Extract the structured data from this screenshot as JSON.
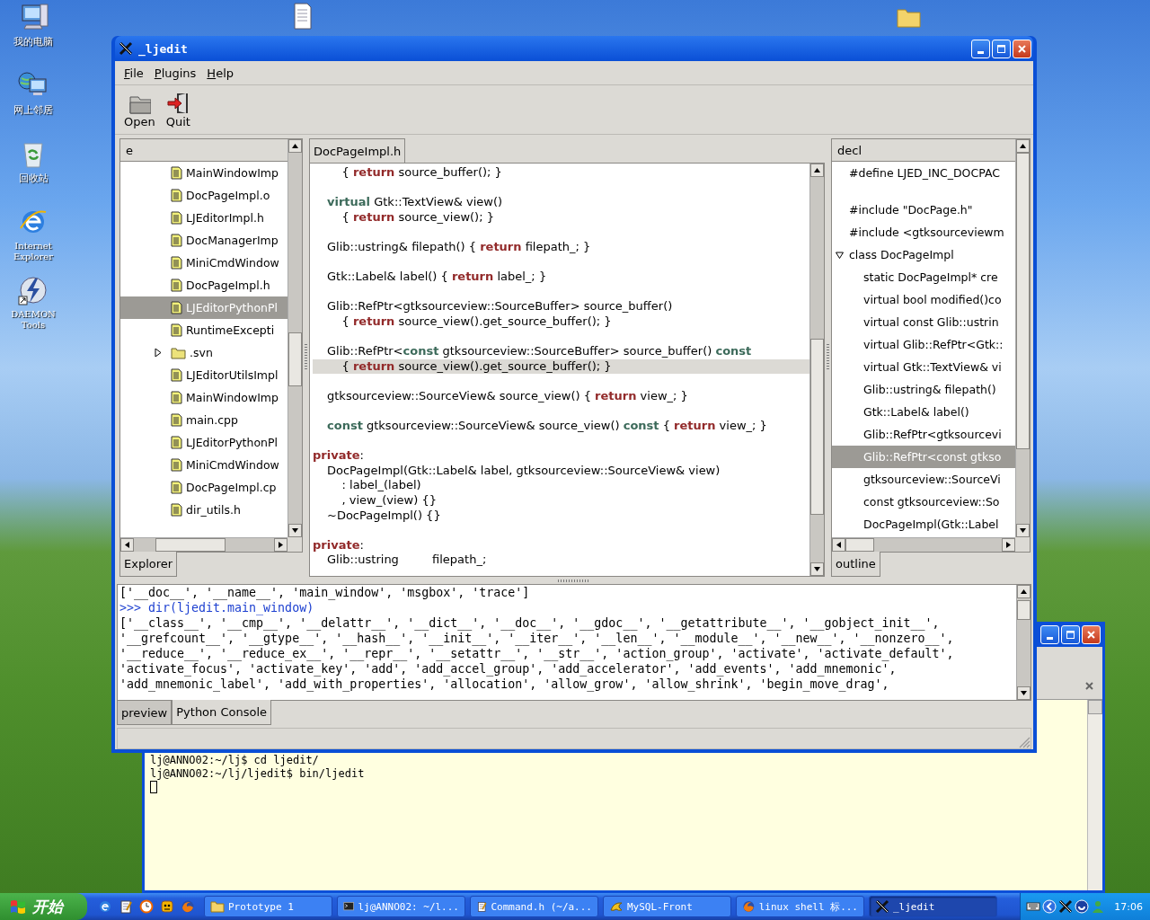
{
  "desktop_icons": [
    {
      "label": "我的电脑"
    },
    {
      "label": "网上邻居"
    },
    {
      "label": "回收站"
    },
    {
      "label": "Internet Explorer"
    },
    {
      "label": "DAEMON Tools"
    }
  ],
  "window": {
    "title": "_ljedit"
  },
  "menu": [
    "File",
    "Plugins",
    "Help"
  ],
  "toolbar": [
    {
      "label": "Open"
    },
    {
      "label": "Quit"
    }
  ],
  "explorer": {
    "column_1": "e",
    "items": [
      {
        "kind": "file",
        "label": "MainWindowImp",
        "selected": false
      },
      {
        "kind": "file",
        "label": "DocPageImpl.o",
        "selected": false
      },
      {
        "kind": "file",
        "label": "LJEditorImpl.h",
        "selected": false
      },
      {
        "kind": "file",
        "label": "DocManagerImp",
        "selected": false
      },
      {
        "kind": "file",
        "label": "MiniCmdWindow",
        "selected": false
      },
      {
        "kind": "file",
        "label": "DocPageImpl.h",
        "selected": false
      },
      {
        "kind": "file",
        "label": "LJEditorPythonPl",
        "selected": true
      },
      {
        "kind": "file",
        "label": "RuntimeExcepti",
        "selected": false
      },
      {
        "kind": "folder",
        "label": ".svn",
        "selected": false,
        "expanded": false
      },
      {
        "kind": "file",
        "label": "LJEditorUtilsImpl",
        "selected": false
      },
      {
        "kind": "file",
        "label": "MainWindowImp",
        "selected": false
      },
      {
        "kind": "file",
        "label": "main.cpp",
        "selected": false
      },
      {
        "kind": "file",
        "label": "LJEditorPythonPl",
        "selected": false
      },
      {
        "kind": "file",
        "label": "MiniCmdWindow",
        "selected": false
      },
      {
        "kind": "file",
        "label": "DocPageImpl.cp",
        "selected": false
      },
      {
        "kind": "file",
        "label": "dir_utils.h",
        "selected": false
      }
    ],
    "tabs": [
      {
        "label": "Explorer",
        "selected": true
      }
    ]
  },
  "editor": {
    "tabs": [
      {
        "label": "DocPageImpl.h",
        "selected": true
      }
    ],
    "blocks": [
      {
        "lines": [
          {
            "indented": true,
            "highlighted": false,
            "segments": [
              {
                "kind": "plain",
                "text": "    { "
              },
              {
                "kind": "keyword",
                "text": "return"
              },
              {
                "kind": "plain",
                "text": " source_buffer(); }"
              }
            ]
          }
        ]
      },
      {
        "lines": [
          {
            "indented": true,
            "highlighted": false,
            "segments": [
              {
                "kind": "qualifier",
                "text": "virtual"
              },
              {
                "kind": "plain",
                "text": " Gtk::TextView& view()"
              }
            ]
          },
          {
            "indented": true,
            "highlighted": false,
            "segments": [
              {
                "kind": "plain",
                "text": "    { "
              },
              {
                "kind": "keyword",
                "text": "return"
              },
              {
                "kind": "plain",
                "text": " source_view(); }"
              }
            ]
          }
        ]
      },
      {
        "lines": [
          {
            "indented": true,
            "highlighted": false,
            "segments": [
              {
                "kind": "plain",
                "text": "Glib::ustring& filepath() { "
              },
              {
                "kind": "keyword",
                "text": "return"
              },
              {
                "kind": "plain",
                "text": " filepath_; }"
              }
            ]
          }
        ]
      },
      {
        "lines": [
          {
            "indented": true,
            "highlighted": false,
            "segments": [
              {
                "kind": "plain",
                "text": "Gtk::Label& label() { "
              },
              {
                "kind": "keyword",
                "text": "return"
              },
              {
                "kind": "plain",
                "text": " label_; }"
              }
            ]
          }
        ]
      },
      {
        "lines": [
          {
            "indented": true,
            "highlighted": false,
            "segments": [
              {
                "kind": "plain",
                "text": "Glib::RefPtr<gtksourceview::SourceBuffer> source_buffer()"
              }
            ]
          },
          {
            "indented": true,
            "highlighted": false,
            "segments": [
              {
                "kind": "plain",
                "text": "    { "
              },
              {
                "kind": "keyword",
                "text": "return"
              },
              {
                "kind": "plain",
                "text": " source_view().get_source_buffer(); }"
              }
            ]
          }
        ]
      },
      {
        "lines": [
          {
            "indented": true,
            "highlighted": false,
            "segments": [
              {
                "kind": "plain",
                "text": "Glib::RefPtr<"
              },
              {
                "kind": "qualifier",
                "text": "const"
              },
              {
                "kind": "plain",
                "text": " gtksourceview::SourceBuffer> source_buffer() "
              },
              {
                "kind": "qualifier",
                "text": "const"
              }
            ]
          },
          {
            "indented": true,
            "highlighted": true,
            "segments": [
              {
                "kind": "plain",
                "text": "    { "
              },
              {
                "kind": "keyword",
                "text": "return"
              },
              {
                "kind": "plain",
                "text": " source_view().get_source_buffer(); }"
              }
            ]
          }
        ]
      },
      {
        "lines": [
          {
            "indented": true,
            "highlighted": false,
            "segments": [
              {
                "kind": "plain",
                "text": "gtksourceview::SourceView& source_view() { "
              },
              {
                "kind": "keyword",
                "text": "return"
              },
              {
                "kind": "plain",
                "text": " view_; }"
              }
            ]
          }
        ]
      },
      {
        "lines": [
          {
            "indented": true,
            "highlighted": false,
            "segments": [
              {
                "kind": "qualifier",
                "text": "const"
              },
              {
                "kind": "plain",
                "text": " gtksourceview::SourceView& source_view() "
              },
              {
                "kind": "qualifier",
                "text": "const"
              },
              {
                "kind": "plain",
                "text": " { "
              },
              {
                "kind": "keyword",
                "text": "return"
              },
              {
                "kind": "plain",
                "text": " view_; }"
              }
            ]
          }
        ]
      },
      {
        "lines": [
          {
            "indented": false,
            "highlighted": false,
            "segments": [
              {
                "kind": "keyword",
                "text": "private"
              },
              {
                "kind": "plain",
                "text": ":"
              }
            ]
          },
          {
            "indented": true,
            "highlighted": false,
            "segments": [
              {
                "kind": "plain",
                "text": "DocPageImpl(Gtk::Label& label, gtksourceview::SourceView& view)"
              }
            ]
          },
          {
            "indented": true,
            "highlighted": false,
            "segments": [
              {
                "kind": "plain",
                "text": "    : label_(label)"
              }
            ]
          },
          {
            "indented": true,
            "highlighted": false,
            "segments": [
              {
                "kind": "plain",
                "text": "    , view_(view) {}"
              }
            ]
          },
          {
            "indented": true,
            "highlighted": false,
            "segments": [
              {
                "kind": "plain",
                "text": "~DocPageImpl() {}"
              }
            ]
          }
        ]
      },
      {
        "lines": [
          {
            "indented": false,
            "highlighted": false,
            "segments": [
              {
                "kind": "keyword",
                "text": "private"
              },
              {
                "kind": "plain",
                "text": ":"
              }
            ]
          },
          {
            "indented": true,
            "highlighted": false,
            "segments": [
              {
                "kind": "plain",
                "text": "Glib::ustring         filepath_;"
              }
            ]
          }
        ]
      }
    ]
  },
  "outline": {
    "header": "decl",
    "items": [
      {
        "kind": "decl",
        "label": "#define LJED_INC_DOCPAC",
        "selected": false
      },
      {
        "kind": "blank"
      },
      {
        "kind": "decl",
        "label": "#include \"DocPage.h\"",
        "selected": false
      },
      {
        "kind": "decl",
        "label": "#include <gtksourceviewm",
        "selected": false
      },
      {
        "kind": "decl",
        "label": "class DocPageImpl",
        "selected": false,
        "expanded": true,
        "children": [
          {
            "kind": "decl",
            "label": "static DocPageImpl* cre",
            "selected": false
          },
          {
            "kind": "decl",
            "label": "virtual bool modified()co",
            "selected": false
          },
          {
            "kind": "decl",
            "label": "virtual const Glib::ustrin",
            "selected": false
          },
          {
            "kind": "decl",
            "label": "virtual Glib::RefPtr<Gtk::",
            "selected": false
          },
          {
            "kind": "decl",
            "label": "virtual Gtk::TextView& vi",
            "selected": false
          },
          {
            "kind": "decl",
            "label": "Glib::ustring& filepath()",
            "selected": false
          },
          {
            "kind": "decl",
            "label": "Gtk::Label& label()",
            "selected": false
          },
          {
            "kind": "decl",
            "label": "Glib::RefPtr<gtksourcevi",
            "selected": false
          },
          {
            "kind": "decl",
            "label": "Glib::RefPtr<const gtkso",
            "selected": true
          },
          {
            "kind": "decl",
            "label": "gtksourceview::SourceVi",
            "selected": false
          },
          {
            "kind": "decl",
            "label": "const gtksourceview::So",
            "selected": false
          },
          {
            "kind": "decl",
            "label": "DocPageImpl(Gtk::Label",
            "selected": false
          }
        ]
      }
    ],
    "tabs": [
      {
        "label": "outline",
        "selected": true
      }
    ]
  },
  "console": {
    "lines": [
      {
        "kind": "output",
        "text": "['__doc__', '__name__', 'main_window', 'msgbox', 'trace']"
      },
      {
        "kind": "input",
        "text": ">>> dir(ljedit.main_window)"
      },
      {
        "kind": "output",
        "text": "['__class__', '__cmp__', '__delattr__', '__dict__', '__doc__', '__gdoc__', '__getattribute__', '__gobject_init__',"
      },
      {
        "kind": "output",
        "text": "'__grefcount__', '__gtype__', '__hash__', '__init__', '__iter__', '__len__', '__module__', '__new__', '__nonzero__',"
      },
      {
        "kind": "output",
        "text": "'__reduce__', '__reduce_ex__', '__repr__', '__setattr__', '__str__', 'action_group', 'activate', 'activate_default',"
      },
      {
        "kind": "output",
        "text": "'activate_focus', 'activate_key', 'add', 'add_accel_group', 'add_accelerator', 'add_events', 'add_mnemonic',"
      },
      {
        "kind": "output",
        "text": "'add_mnemonic_label', 'add_with_properties', 'allocation', 'allow_grow', 'allow_shrink', 'begin_move_drag',"
      }
    ]
  },
  "bottom_tabs": [
    {
      "label": "preview",
      "selected": false
    },
    {
      "label": "Python Console",
      "selected": true
    }
  ],
  "terminal": {
    "lines": [
      "lj@ANNO02:~/lj$ cd ljedit/",
      "lj@ANNO02:~/lj/ljedit$ bin/ljedit"
    ]
  },
  "taskbar": {
    "start": "开始",
    "tasks": [
      {
        "label": "Prototype 1",
        "selected": false
      },
      {
        "label": "lj@ANNO02: ~/l...",
        "selected": false
      },
      {
        "label": "Command.h (~/a...",
        "selected": false
      },
      {
        "label": "MySQL-Front",
        "selected": false
      },
      {
        "label": "linux shell 标...",
        "selected": false
      },
      {
        "label": "_ljedit",
        "selected": true
      }
    ],
    "clock": "17:06"
  }
}
